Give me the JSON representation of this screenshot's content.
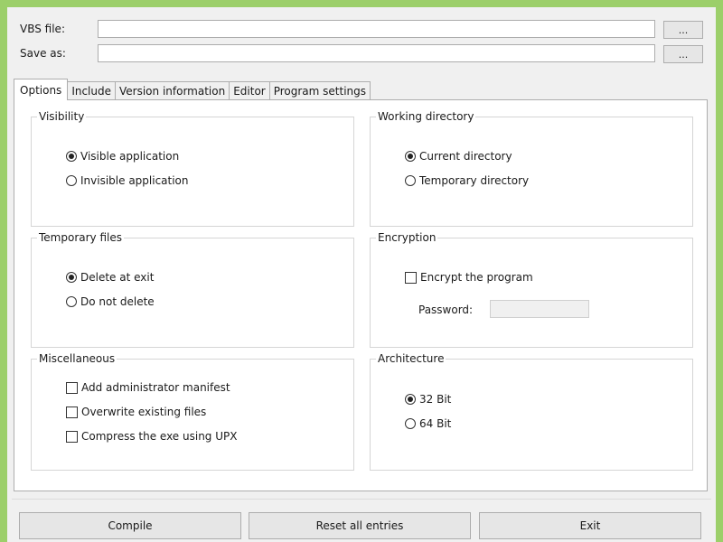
{
  "form": {
    "vbs_label": "VBS file:",
    "vbs_value": "",
    "saveas_label": "Save as:",
    "saveas_value": "",
    "browse_label": "..."
  },
  "tabs": [
    "Options",
    "Include",
    "Version information",
    "Editor",
    "Program settings"
  ],
  "active_tab": "Options",
  "visibility": {
    "title": "Visibility",
    "options": [
      "Visible application",
      "Invisible application"
    ],
    "selected": "Visible application"
  },
  "working_directory": {
    "title": "Working directory",
    "options": [
      "Current directory",
      "Temporary directory"
    ],
    "selected": "Current directory"
  },
  "temporary_files": {
    "title": "Temporary files",
    "options": [
      "Delete at exit",
      "Do not delete"
    ],
    "selected": "Delete at exit"
  },
  "encryption": {
    "title": "Encryption",
    "encrypt_label": "Encrypt the program",
    "encrypt_checked": false,
    "password_label": "Password:",
    "password_value": ""
  },
  "miscellaneous": {
    "title": "Miscellaneous",
    "options": [
      "Add administrator manifest",
      "Overwrite existing files",
      "Compress the exe using UPX"
    ],
    "checked": [
      false,
      false,
      false
    ]
  },
  "architecture": {
    "title": "Architecture",
    "options": [
      "32 Bit",
      "64 Bit"
    ],
    "selected": "32 Bit"
  },
  "buttons": {
    "compile": "Compile",
    "reset": "Reset all entries",
    "exit": "Exit"
  }
}
